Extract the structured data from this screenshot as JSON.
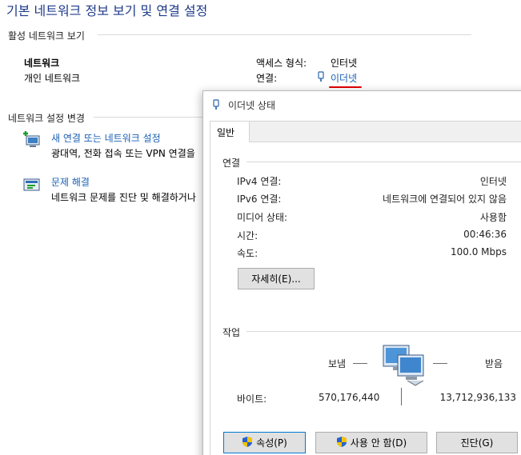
{
  "page": {
    "title": "기본 네트워크 정보 보기 및 연결 설정",
    "active_section": "활성 네트워크 보기",
    "network_name": "네트워크",
    "network_type": "개인 네트워크",
    "access_type_label": "액세스 형식:",
    "access_type_value": "인터넷",
    "connections_label": "연결:",
    "connection_link": "이더넷",
    "settings_section": "네트워크 설정 변경",
    "new_conn_link": "새 연결 또는 네트워크 설정",
    "new_conn_desc": "광대역, 전화 접속 또는 VPN 연결을",
    "troubleshoot_link": "문제 해결",
    "troubleshoot_desc": "네트워크 문제를 진단 및 해결하거나"
  },
  "dialog": {
    "title": "이더넷 상태",
    "tab_general": "일반",
    "connection_group": "연결",
    "rows": [
      {
        "label": "IPv4 연결:",
        "value": "인터넷"
      },
      {
        "label": "IPv6 연결:",
        "value": "네트워크에 연결되어 있지 않음"
      },
      {
        "label": "미디어 상태:",
        "value": "사용함"
      },
      {
        "label": "시간:",
        "value": "00:46:36"
      },
      {
        "label": "속도:",
        "value": "100.0 Mbps"
      }
    ],
    "details_button": "자세히(E)...",
    "activity_group": "작업",
    "sent_label": "보냄",
    "received_label": "받음",
    "bytes_label": "바이트:",
    "bytes_sent": "570,176,440",
    "bytes_received": "13,712,936,133",
    "properties_button": "속성(P)",
    "disable_button": "사용 안 함(D)",
    "diagnose_button": "진단(G)"
  },
  "colors": {
    "link": "#1a5fb4",
    "title": "#1e3a8a",
    "annotation_red": "#e00000"
  }
}
